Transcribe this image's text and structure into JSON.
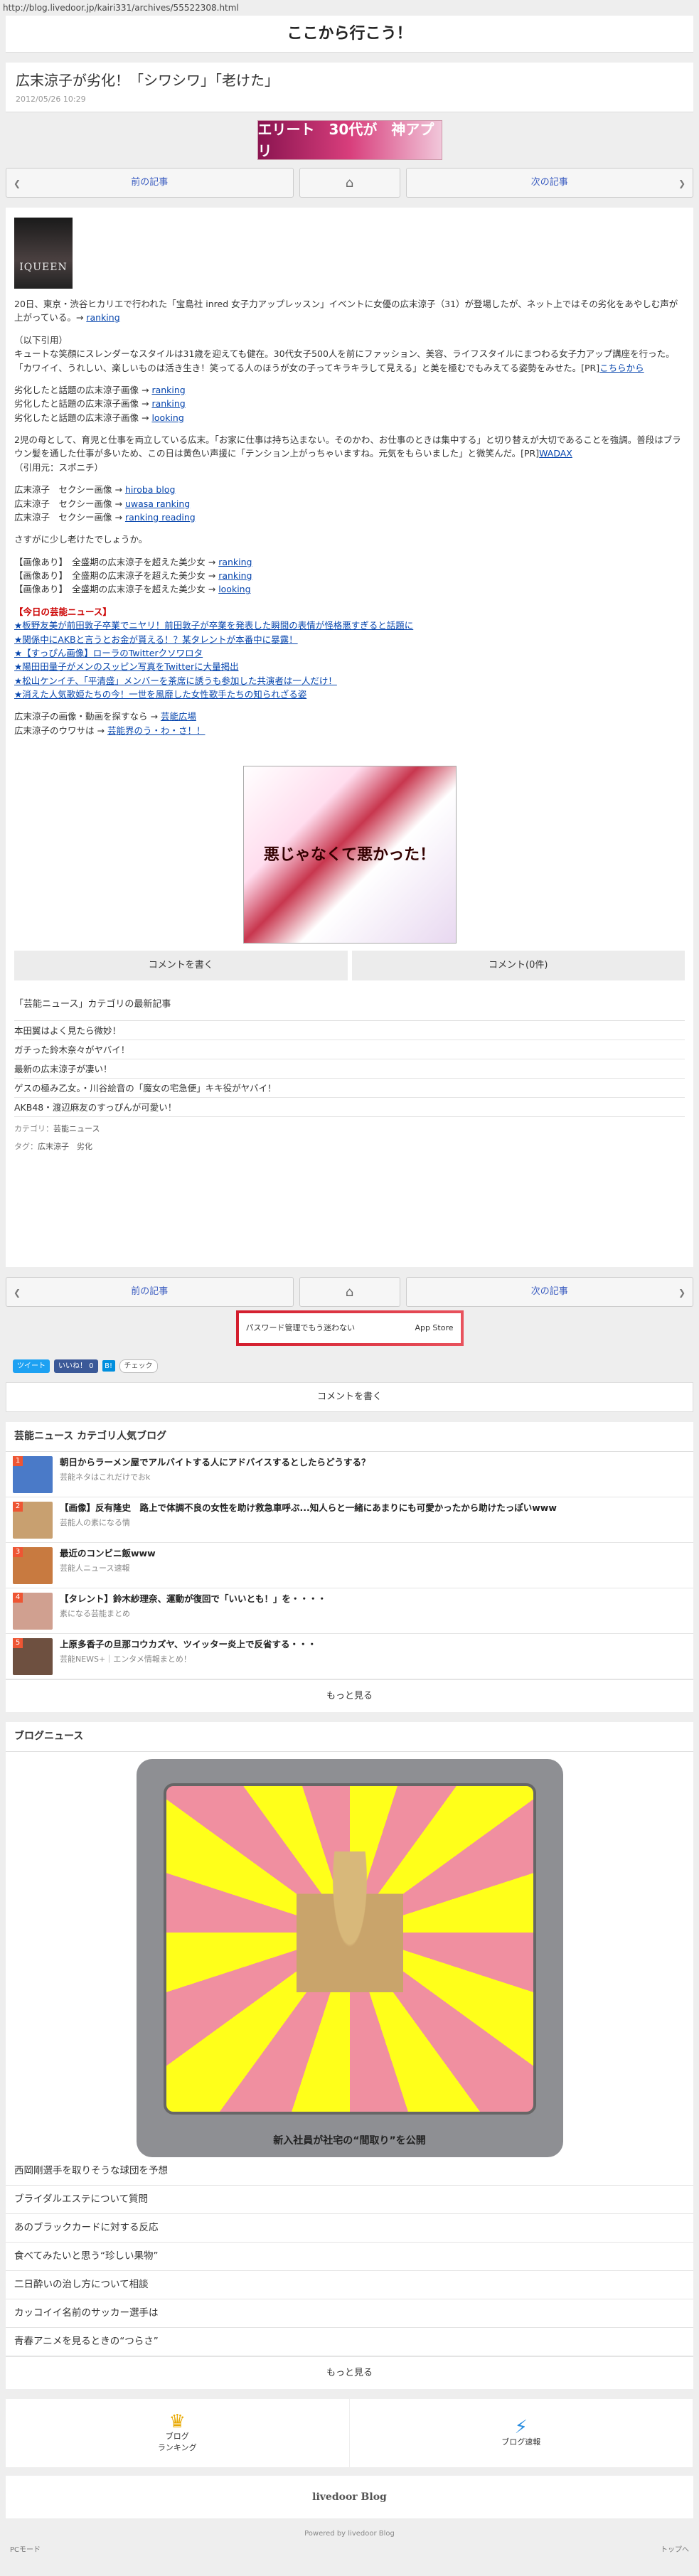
{
  "url": "http://blog.livedoor.jp/kairi331/archives/55522308.html",
  "blog_title": "ここから行こう！",
  "article": {
    "title": "広末涼子が劣化！「シワシワ」「老けた」",
    "date": "2012/05/26 10:29",
    "photo_label": "IQUEEN",
    "p1": "20日、東京・渋谷ヒカリエで行われた「宝島社 inred 女子力アップレッスン」イベントに女優の広末涼子（31）が登場したが、ネット上ではその劣化をあやしむ声が上がっている。→",
    "p1_link": "ranking",
    "quote_head": "（以下引用）",
    "quote": "キュートな笑顔にスレンダーなスタイルは31歳を迎えても健在。30代女子500人を前にファッション、美容、ライフスタイルにまつわる女子力アップ講座を行った。「カワイイ、うれしい、楽しいものは活き生き！笑ってる人のほうが女の子ってキラキラして見える」と美を極むでもみえてる姿勢をみせた。",
    "quote_link_pre": "[PR]",
    "quote_link": "こちらから",
    "links_a": [
      {
        "pre": "劣化したと話題の広末涼子画像 →",
        "link": "ranking"
      },
      {
        "pre": "劣化したと話題の広末涼子画像 →",
        "link": "ranking"
      },
      {
        "pre": "劣化したと話題の広末涼子画像 →",
        "link": "looking"
      }
    ],
    "p2": "2児の母として、育児と仕事を両立している広末。「お家に仕事は持ち込まない。そのかわ、お仕事のときは集中する」と切り替えが大切であることを強調。普段はブラウン髪を通した仕事が多いため、この日は黄色い声援に「テンション上がっちゃいますね。元気をもらいました」と微笑んだ。[PR]",
    "p2_link": "WADAX",
    "p2_source": "（引用元：スポニチ）",
    "links_b": [
      {
        "pre": "広末涼子　セクシー画像 →",
        "link": "hiroba blog"
      },
      {
        "pre": "広末涼子　セクシー画像 →",
        "link": "uwasa ranking"
      },
      {
        "pre": "広末涼子　セクシー画像 →",
        "link": "ranking reading"
      }
    ],
    "p3": "さすがに少し老けたでしょうか。",
    "links_c": [
      {
        "pre": "【画像あり】　全盛期の広末涼子を超えた美少女 →",
        "link": "ranking"
      },
      {
        "pre": "【画像あり】　全盛期の広末涼子を超えた美少女 →",
        "link": "ranking"
      },
      {
        "pre": "【画像あり】　全盛期の広末涼子を超えた美少女 →",
        "link": "looking"
      }
    ],
    "today_head": "【今日の芸能ニュース】",
    "today": [
      "★板野友美が前田敦子卒業でニヤリ！前田敦子が卒業を発表した瞬間の表情が怪格悪すぎると話題に",
      "★関係中にAKBと言うとお金が貰える！？某タレントが本番中に暴露！",
      "★【すっぴん画像】ローラのTwitterクソワロタ",
      "★陽田田量子がメンのスッピン写真をTwitterに大量掲出",
      "★松山ケンイチ、「平清盛」メンバーを茶席に誘うも参加した共演者は一人だけ！",
      "★消えた人気歌姫たちの今！一世を風靡した女性歌手たちの知られざる姿"
    ],
    "movie_pre": "広末涼子の画像・動画を探すなら →",
    "movie_link": "芸能広場",
    "rumor_pre": "広末涼子のウワサは →",
    "rumor_link": "芸能界のう・わ・さ！！",
    "manga_text": "悪じゃなくて悪かった！"
  },
  "nav": {
    "prev": "前の記事",
    "next": "次の記事"
  },
  "buttons": {
    "write_comment": "コメントを書く",
    "comments": "コメント(0件)"
  },
  "category": {
    "title": "「芸能ニュース」カテゴリの最新記事",
    "items": [
      "本田翼はよく見たら微妙！",
      "ガチった鈴木奈々がヤバイ！",
      "最新の広末涼子が凄い！",
      "ゲスの極み乙女。・川谷絵音の「魔女の宅急便」キキ役がヤバイ！",
      "AKB48・渡辺麻友のすっぴんが可愛い！"
    ],
    "cat_label": "カテゴリ：",
    "cat_value": "芸能ニュース",
    "tag_label": "タグ：",
    "tag_values": "広末涼子　劣化"
  },
  "banner_top": "エリート　30代が　神アプリ",
  "banner2": {
    "left": "パスワード管理でもう迷わない",
    "right": "App Store"
  },
  "social": {
    "tweet": "ツイート",
    "like": "いいね！ 0",
    "hatena": "B!",
    "check": "チェック"
  },
  "popular": {
    "title": "芸能ニュース カテゴリ人気ブログ",
    "items": [
      {
        "title": "朝日からラーメン屋でアルバイトする人にアドバイスするとしたらどうする？",
        "sub": "芸能ネタはこれだけでおk",
        "color": "#4a7ac8"
      },
      {
        "title": "【画像】反有隆史　路上で体調不良の女性を助け救急車呼ぶ...知人らと一緒にあまりにも可愛かったから助けたっぽいwww",
        "sub": "芸能人の素になる情",
        "color": "#c8a070"
      },
      {
        "title": "最近のコンビニ飯www",
        "sub": "芸能人ニュース速報",
        "color": "#c87a40"
      },
      {
        "title": "【タレント】鈴木紗理奈、運動が復回で「いいとも！」を・・・・",
        "sub": "素になる芸能まとめ",
        "color": "#d0a090"
      },
      {
        "title": "上原多香子の旦那コウカズヤ、ツイッター炎上で反省する・・・",
        "sub": "芸能NEWS+｜エンタメ情報まとめ！",
        "color": "#6e5040"
      }
    ],
    "more": "もっと見る"
  },
  "blognews": {
    "title": "ブログニュース",
    "caption": "新入社員が社宅の“間取り”を公開",
    "items": [
      "西岡剛選手を取りそうな球団を予想",
      "ブライダルエステについて質問",
      "あのブラックカードに対する反応",
      "食べてみたいと思う“珍しい果物”",
      "二日酔いの治し方について相談",
      "カッコイイ名前のサッカー選手は",
      "青春アニメを見るときの“つらさ”"
    ],
    "more": "もっと見る"
  },
  "footer": {
    "ranking": "ブログ\nランキング",
    "speed": "ブログ速報",
    "logo": "livedoor Blog",
    "powered": "Powered by livedoor Blog",
    "pc": "PCモード",
    "top": "トップへ"
  }
}
